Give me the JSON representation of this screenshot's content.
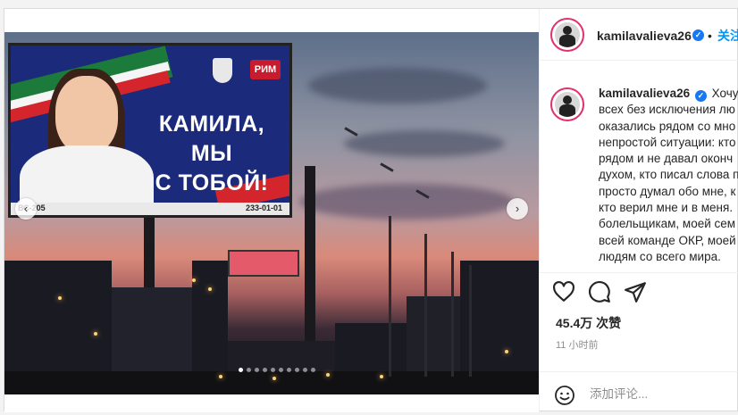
{
  "post": {
    "username": "kamilavalieva26",
    "follow_separator": "•",
    "follow_label": "关注",
    "verified_glyph": "✓",
    "caption_lines": [
      "Хочу п",
      "всех без исключения лю",
      "оказались рядом со мно",
      "непростой ситуации: кто",
      "рядом и не давал оконч",
      "духом, кто писал слова п",
      "просто думал обо мне, к",
      "кто верил мне и в меня.",
      "болельщикам, моей сем",
      "всей команде ОКР, моей",
      "людям со всего мира."
    ],
    "likes": "45.4万 次赞",
    "time_ago": "11 小时前",
    "comment_placeholder": "添加评论...",
    "carousel_total": 10,
    "carousel_active": 0
  },
  "photo": {
    "billboard_text_line1": "КАМИЛА, МЫ",
    "billboard_text_line2": "С ТОБОЙ!",
    "billboard_logo": "РИМ",
    "billboard_code_left": "ВС-205",
    "billboard_code_right": "233-01-01",
    "prev_glyph": "‹",
    "next_glyph": "›"
  },
  "icons": {
    "heart": "heart-icon",
    "comment": "comment-icon",
    "share": "share-icon",
    "emoji": "emoji-icon",
    "verified": "verified-badge-icon"
  },
  "colors": {
    "link_blue": "#0095f6",
    "verified_blue": "#1877f2",
    "text": "#262626",
    "muted": "#8e8e8e",
    "border": "#efefef"
  }
}
